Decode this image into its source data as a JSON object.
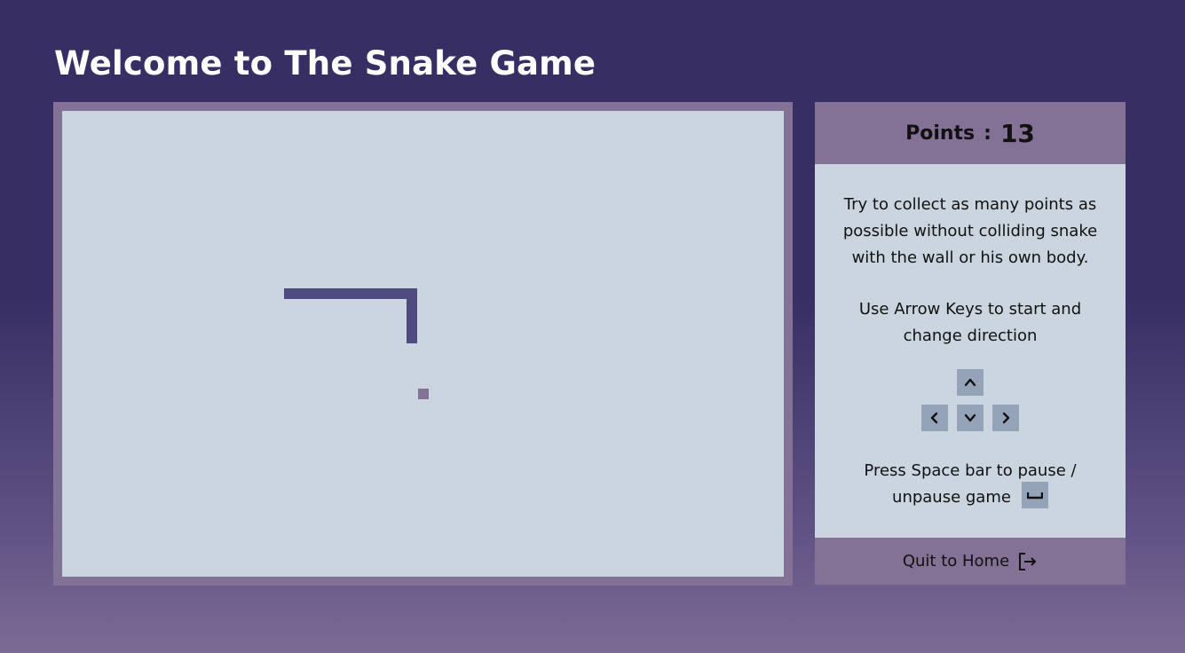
{
  "header": {
    "title": "Welcome to The Snake Game"
  },
  "score": {
    "label": "Points",
    "separator": ":",
    "value": "13"
  },
  "instructions": {
    "line1": "Try to collect as many points as possible without colliding snake with the wall or his own body.",
    "line2": "Use Arrow Keys to start and change direction",
    "line3": "Press Space bar to pause / unpause game"
  },
  "keys": [
    "arrow-up-icon",
    "arrow-left-icon",
    "arrow-down-icon",
    "arrow-right-icon",
    "space-bar-icon"
  ],
  "quit": {
    "label": "Quit to Home",
    "icon": "logout-icon"
  },
  "colors": {
    "background_top": "#372e63",
    "background_bottom": "#7c6b94",
    "board_frame": "#837295",
    "board": "#cbd5e0",
    "snake": "#4f4b80",
    "food": "#837295",
    "key": "#95a3b8"
  }
}
